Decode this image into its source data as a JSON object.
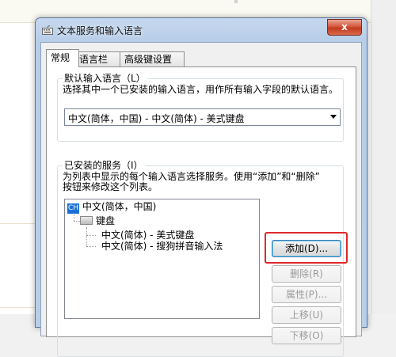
{
  "window": {
    "title": "文本服务和输入语言",
    "close_glyph": "x"
  },
  "tabs": [
    {
      "label": "常规",
      "active": true
    },
    {
      "label": "语言栏",
      "active": false
    },
    {
      "label": "高级键设置",
      "active": false
    }
  ],
  "default_language": {
    "group_label": "默认输入语言（L）",
    "description": "选择其中一个已安装的输入语言，用作所有输入字段的默认语言。",
    "selected": "中文(简体，中国) - 中文(简体) - 美式键盘"
  },
  "installed_services": {
    "group_label": "已安装的服务（I）",
    "description_line1": "为列表中显示的每个输入语言选择服务。使用“添加”和“删除”",
    "description_line2": "按钮来修改这个列表。",
    "tree": {
      "language_badge": "CH",
      "language": "中文(简体，中国)",
      "category": "键盘",
      "items": [
        "中文(简体) - 美式键盘",
        "中文(简体) - 搜狗拼音输入法"
      ]
    }
  },
  "buttons": {
    "add": "添加(D)...",
    "remove": "删除(R)",
    "properties": "属性(P)...",
    "move_up": "上移(U)",
    "move_down": "下移(O)"
  },
  "colors": {
    "highlight_box": "#e0282b",
    "language_badge": "#1a6fd6"
  }
}
